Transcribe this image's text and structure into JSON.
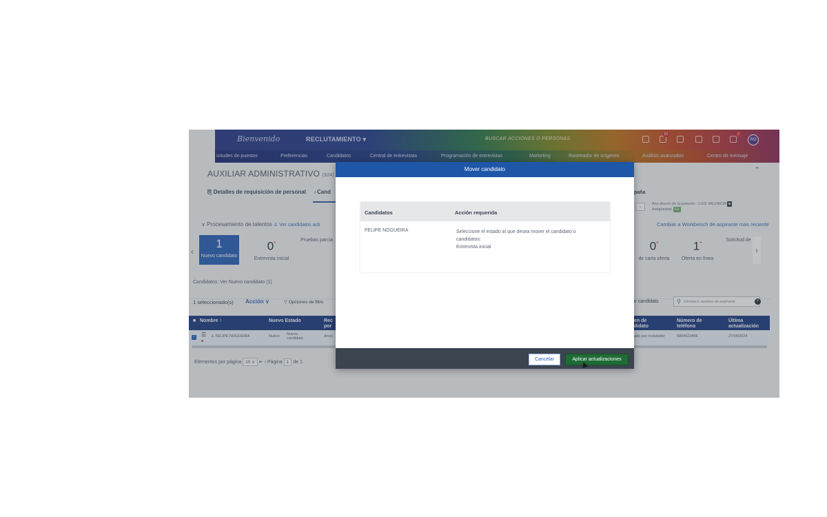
{
  "header": {
    "logo": "Bienvenido",
    "module": "RECLUTAMIENTO ▾",
    "search_placeholder": "BUSCAR ACCIONES O PERSONAS",
    "badges": [
      "52",
      "2"
    ],
    "avatar_initials": "RO"
  },
  "nav": [
    "icitudes de puestos",
    "Preferencias",
    "Candidatos",
    "Central de entrevistas",
    "Programación de entrevistas",
    "Marketing",
    "Rastreador de orígenes",
    "Análisis avanzados",
    "Centro de mensaje"
  ],
  "page": {
    "title": "AUXILIAR ADMINISTRATIVO",
    "title_id": "(924)",
    "tabs": [
      "Detalles de requisición de personal",
      "Cand"
    ],
    "right_section": "paña",
    "director_line1": "Ans directo de la posición : LUIS VALENCIA",
    "director_line2": "Antigüedad:",
    "director_tag": "ES",
    "section_label": "Procesamiento de talentos",
    "section_link": "Ver candidatos acti",
    "workbench_link": "Cambiar a Workbench de aspirante más reciente"
  },
  "stages": [
    {
      "count": "1",
      "star": "",
      "label": "Nuevo candidato"
    },
    {
      "count": "0",
      "star": "*",
      "label": "Entrevista inicial"
    },
    {
      "count": "",
      "star": "",
      "label": "Pruebas parcia"
    },
    {
      "count": "0",
      "star": "*",
      "label": "de carta oferta"
    },
    {
      "count": "1",
      "star": "*",
      "label": "Oferta en línea"
    },
    {
      "count": "",
      "star": "",
      "label": "Solicitud de"
    }
  ],
  "candidates": {
    "label": "Candidatos: Ver Nuevo candidato (1)",
    "selected": "1 seleccionado(s)",
    "action": "Acción ∨",
    "filter": "Opciones de filtro",
    "arrange": "ltar candidats",
    "search_placeholder": "Introducir nombre de aspirante"
  },
  "table": {
    "headers": [
      "Nombre",
      "Nuevo Estado",
      "Rec\npor",
      "en de\ndidato",
      "Número de\nteléfono",
      "Última\nactualización"
    ],
    "row": {
      "name": "FELIPE NOGUEIRA",
      "new_state": "Nuevo",
      "new_state2": "Nuevo\ncandidato",
      "rec": "Anco",
      "origin": "ado por reclutador",
      "phone": "5804923406",
      "updated": "27/05/2024"
    }
  },
  "pager": {
    "label": "Elementos por página",
    "per_page": "10",
    "nav": "⇤ ‹ Página",
    "page": "1",
    "of": "de 1"
  },
  "modal": {
    "title": "Mover candidato",
    "col1": "Candidatos",
    "col2": "Acción requerida",
    "candidate": "FELIPE NOGUEIRA",
    "action_line1": "Seleccione el estado al que desea mover el candidato o",
    "action_line2": "candidatos:",
    "action_line3": "Entrevista inicial",
    "cancel": "Cancelar",
    "apply": "Aplicar actualizaciones"
  }
}
